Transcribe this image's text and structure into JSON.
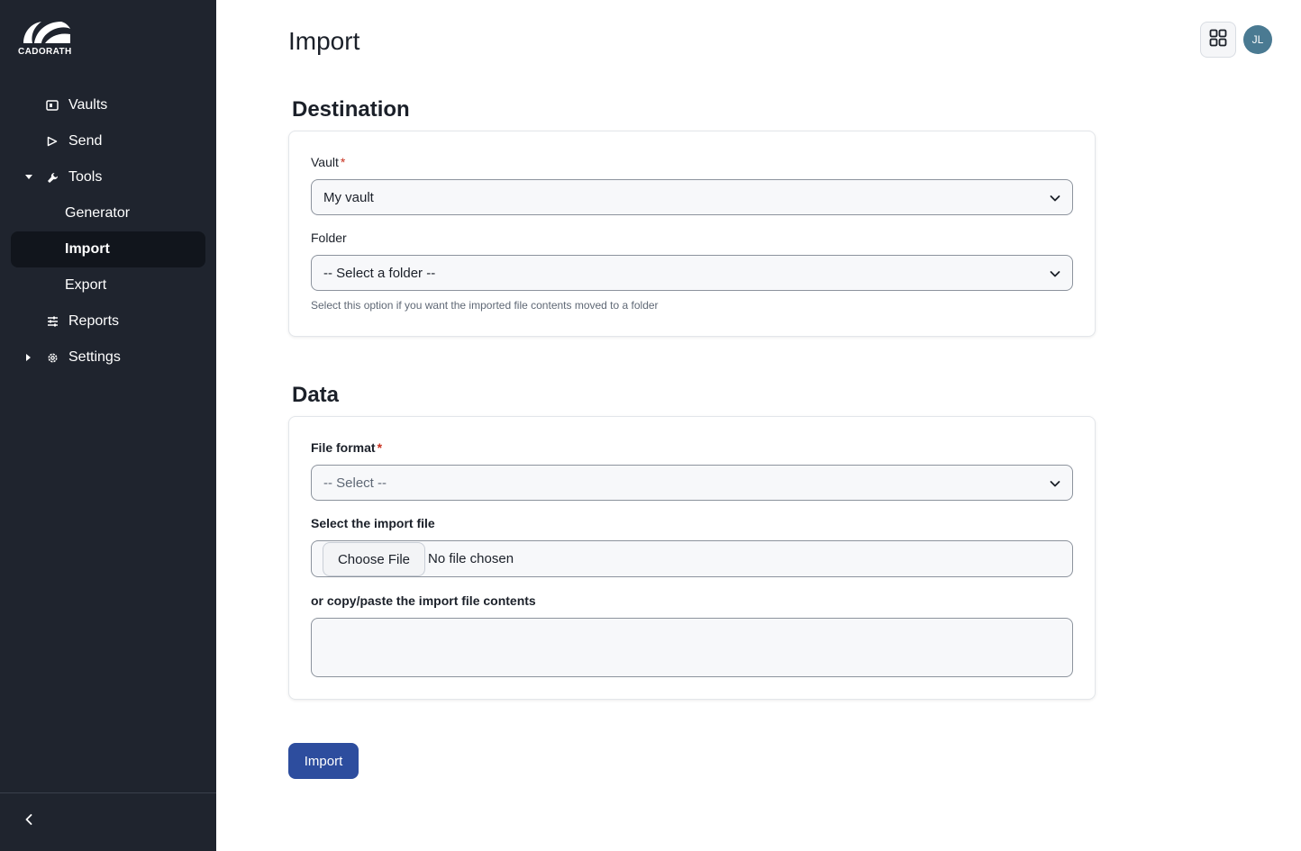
{
  "brand": {
    "name": "CADORATH"
  },
  "sidebar": {
    "items": [
      {
        "label": "Vaults",
        "icon": "vault-icon"
      },
      {
        "label": "Send",
        "icon": "send-icon"
      },
      {
        "label": "Tools",
        "icon": "wrench-icon",
        "expanded": true
      },
      {
        "label": "Generator"
      },
      {
        "label": "Import",
        "active": true
      },
      {
        "label": "Export"
      },
      {
        "label": "Reports",
        "icon": "sliders-icon"
      },
      {
        "label": "Settings",
        "icon": "gear-icon",
        "expanded": false
      }
    ],
    "collapse_icon": "chevron-left-icon"
  },
  "header": {
    "title": "Import",
    "apps_icon": "grid-icon",
    "avatar_initials": "JL",
    "avatar_color": "#4a7a92"
  },
  "destination": {
    "section_title": "Destination",
    "vault_label": "Vault",
    "vault_value": "My vault",
    "folder_label": "Folder",
    "folder_value": "-- Select a folder --",
    "folder_hint": "Select this option if you want the imported file contents moved to a folder",
    "required_mark": "*"
  },
  "data": {
    "section_title": "Data",
    "file_format_label": "File format",
    "file_format_value": "-- Select --",
    "import_file_label": "Select the import file",
    "choose_file_label": "Choose File",
    "file_status": "No file chosen",
    "paste_label": "or copy/paste the import file contents",
    "paste_value": ""
  },
  "actions": {
    "import_button": "Import",
    "primary_color": "#2d4d9e"
  }
}
